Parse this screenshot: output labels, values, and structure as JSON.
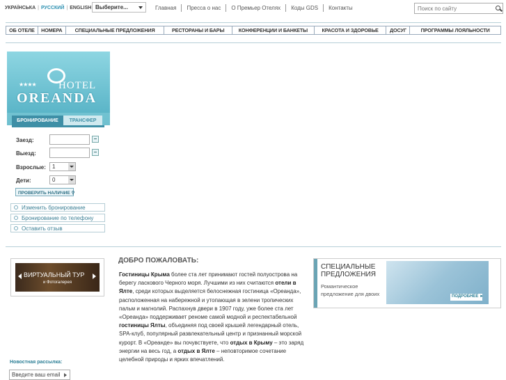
{
  "languages": [
    {
      "label": "УКРАЇНСЬКА",
      "active": false
    },
    {
      "label": "РУССКИЙ",
      "active": true
    },
    {
      "label": "ENGLISH",
      "active": false
    }
  ],
  "language_select": "Выберите...",
  "top_nav": [
    "Главная",
    "Пресса о нас",
    "О Премьер Отелях",
    "Коды GDS",
    "Контакты"
  ],
  "search": {
    "placeholder": "Поиск по сайту"
  },
  "main_nav": [
    "ОБ ОТЕЛЕ",
    "НОМЕРА",
    "СПЕЦИАЛЬНЫЕ ПРЕДЛОЖЕНИЯ",
    "РЕСТОРАНЫ И БАРЫ",
    "КОНФЕРЕНЦИИ И БАНКЕТЫ",
    "КРАСОТА И ЗДОРОВЬЕ",
    "ДОСУГ",
    "ПРОГРАММЫ ЛОЯЛЬНОСТИ"
  ],
  "logo": {
    "stars": "★★★★",
    "hotel": "HOTEL",
    "name": "OREANDA"
  },
  "booking": {
    "tabs": [
      "БРОНИРОВАНИЕ",
      "ТРАНСФЕР"
    ],
    "checkin_label": "Заезд:",
    "checkout_label": "Выезд:",
    "adults_label": "Взрослые:",
    "adults_value": "1",
    "children_label": "Дети:",
    "children_value": "0",
    "check_button": "ПРОВЕРИТЬ НАЛИЧИЕ"
  },
  "side_links": [
    "Изменить бронирование",
    "Бронирование по телефону",
    "Оставить отзыв"
  ],
  "tour": {
    "title": "ВИРТУАЛЬНЫЙ ТУР",
    "subtitle": "и Фотогалерея"
  },
  "newsletter": {
    "label": "Новостная рассылка:",
    "placeholder": "Введите ваш email"
  },
  "welcome": {
    "title": "ДОБРО ПОЖАЛОВАТЬ:"
  },
  "specials": {
    "title_line1": "СПЕЦИАЛЬНЫЕ",
    "title_line2": "ПРЕДЛОЖЕНИЯ",
    "desc": "Романтическое предложение для двоих",
    "more": "ПОДРОБНЕЕ ►"
  }
}
